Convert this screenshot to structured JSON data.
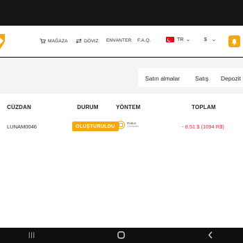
{
  "header": {
    "nav": [
      {
        "label": "MAĞAZA",
        "icon": "cart-icon"
      },
      {
        "label": "DÖVIZ",
        "icon": "swap-icon"
      },
      {
        "label": "ENVANTER"
      },
      {
        "label": "F.A.Q."
      }
    ],
    "language": "TR",
    "currency": "$",
    "accent_color": "#f5a80e"
  },
  "tabs": [
    "Satın almalar",
    "Satış",
    "Depozit"
  ],
  "table": {
    "columns": [
      "CÜZDAN",
      "DURUM",
      "YÖNTEM",
      "TOPLAM"
    ],
    "rows": [
      {
        "wallet": "LUNAM0046",
        "status": "OLUŞTURULDU",
        "method_name": "Robux",
        "method_sub": "Gamepass",
        "total": "- 8.51 $ (1094 R$)"
      }
    ]
  },
  "colors": {
    "negative": "#e0283a",
    "status_badge": "#f5a80e"
  }
}
